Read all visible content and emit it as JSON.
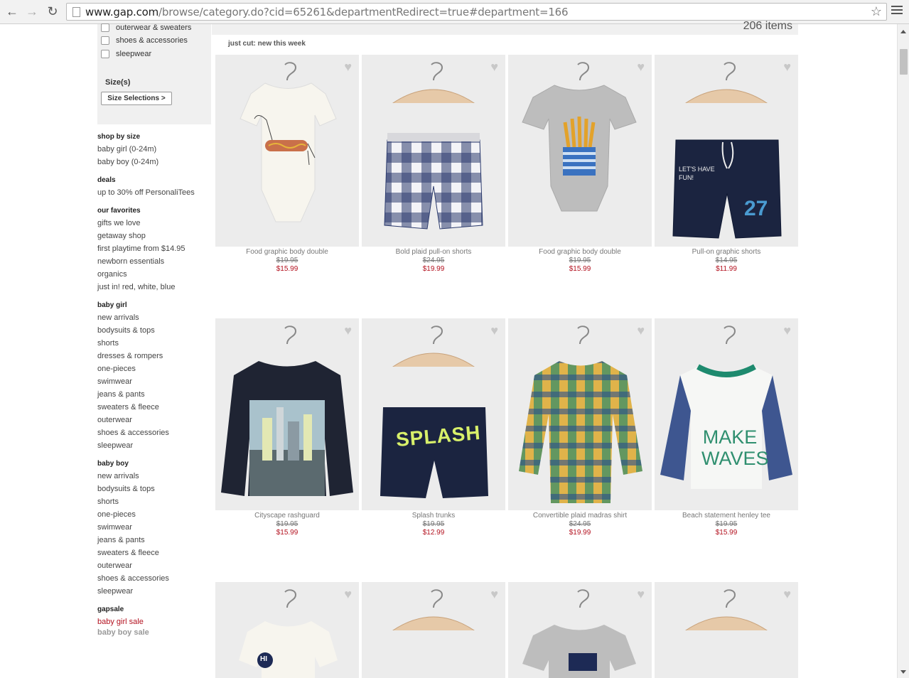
{
  "browser": {
    "url_host": "www.gap.com",
    "url_path": "/browse/category.do?cid=65261&departmentRedirect=true#department=166"
  },
  "filters": {
    "items": [
      "outerwear & sweaters",
      "shoes & accessories",
      "sleepwear"
    ],
    "size_title": "Size(s)",
    "size_button": "Size Selections  >"
  },
  "sidebar": {
    "shop_by_size": {
      "title": "shop by size",
      "links": [
        "baby girl (0-24m)",
        "baby boy (0-24m)"
      ]
    },
    "deals": {
      "title": "deals",
      "links": [
        "up to 30% off PersonaliTees"
      ]
    },
    "our_favorites": {
      "title": "our favorites",
      "links": [
        "gifts we love",
        "getaway shop",
        "first playtime from $14.95",
        "newborn essentials",
        "organics",
        "just in! red, white, blue"
      ]
    },
    "baby_girl": {
      "title": "baby girl",
      "links": [
        "new arrivals",
        "bodysuits & tops",
        "shorts",
        "dresses & rompers",
        "one-pieces",
        "swimwear",
        "jeans & pants",
        "sweaters & fleece",
        "outerwear",
        "shoes & accessories",
        "sleepwear"
      ]
    },
    "baby_boy": {
      "title": "baby boy",
      "links": [
        "new arrivals",
        "bodysuits & tops",
        "shorts",
        "one-pieces",
        "swimwear",
        "jeans & pants",
        "sweaters & fleece",
        "outerwear",
        "shoes & accessories",
        "sleepwear"
      ]
    },
    "gapsale": {
      "title": "gapsale",
      "links": [
        "baby girl sale",
        "baby boy sale"
      ]
    }
  },
  "main": {
    "items_count": "206 items",
    "section_title": "just cut: new this week",
    "products": [
      {
        "name": "Food graphic body double",
        "old_price": "$19.95",
        "new_price": "$15.99"
      },
      {
        "name": "Bold plaid pull-on shorts",
        "old_price": "$24.95",
        "new_price": "$19.99"
      },
      {
        "name": "Food graphic body double",
        "old_price": "$19.95",
        "new_price": "$15.99"
      },
      {
        "name": "Pull-on graphic shorts",
        "old_price": "$14.95",
        "new_price": "$11.99"
      },
      {
        "name": "Cityscape rashguard",
        "old_price": "$19.95",
        "new_price": "$15.99"
      },
      {
        "name": "Splash trunks",
        "old_price": "$19.95",
        "new_price": "$12.99"
      },
      {
        "name": "Convertible plaid madras shirt",
        "old_price": "$24.95",
        "new_price": "$19.99"
      },
      {
        "name": "Beach statement henley tee",
        "old_price": "$19.95",
        "new_price": "$15.99"
      }
    ],
    "garment_text": {
      "shorts_1": "LET'S HAVE FUN!",
      "shorts_number": "27",
      "splash": "SPLASH",
      "make_waves_1": "MAKE",
      "make_waves_2": "WAVES",
      "hi": "HI"
    }
  },
  "icons": {
    "heart": "heart-icon",
    "back": "back-arrow-icon",
    "forward": "forward-arrow-icon",
    "reload": "reload-icon",
    "star": "star-icon",
    "menu": "menu-icon"
  }
}
